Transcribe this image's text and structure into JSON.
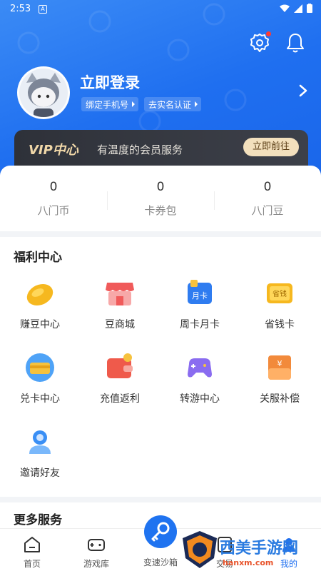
{
  "status_bar": {
    "time": "2:53",
    "notif": "A"
  },
  "header": {
    "login_title": "立即登录",
    "bind_phone": "绑定手机号",
    "real_name": "去实名认证"
  },
  "vip": {
    "logo": "VIP中心",
    "desc": "有温度的会员服务",
    "go": "立即前往"
  },
  "stats": [
    {
      "value": "0",
      "label": "八门币"
    },
    {
      "value": "0",
      "label": "卡券包"
    },
    {
      "value": "0",
      "label": "八门豆"
    }
  ],
  "welfare": {
    "title": "福利中心",
    "items": [
      {
        "label": "赚豆中心",
        "icon": "bean-icon"
      },
      {
        "label": "豆商城",
        "icon": "shop-icon"
      },
      {
        "label": "周卡月卡",
        "icon": "month-card-icon",
        "badge": "月卡"
      },
      {
        "label": "省钱卡",
        "icon": "save-card-icon",
        "badge": "省钱"
      },
      {
        "label": "兑卡中心",
        "icon": "exchange-icon"
      },
      {
        "label": "充值返利",
        "icon": "wallet-icon"
      },
      {
        "label": "转游中心",
        "icon": "gamepad-icon"
      },
      {
        "label": "关服补偿",
        "icon": "compensation-icon"
      },
      {
        "label": "邀请好友",
        "icon": "invite-icon"
      }
    ]
  },
  "more": {
    "title": "更多服务"
  },
  "tabs": [
    {
      "label": "首页",
      "icon": "home-icon"
    },
    {
      "label": "游戏库",
      "icon": "game-library-icon"
    },
    {
      "label": "变速沙箱",
      "icon": "sandbox-icon"
    },
    {
      "label": "交易",
      "icon": "trade-icon"
    },
    {
      "label": "我的",
      "icon": "profile-icon"
    }
  ],
  "watermark": {
    "text": "西美手游网",
    "url": "hanxm.com"
  },
  "colors": {
    "primary": "#1f6ff0",
    "vip_gold": "#f3e0bd",
    "vip_dark": "#2e3139"
  }
}
